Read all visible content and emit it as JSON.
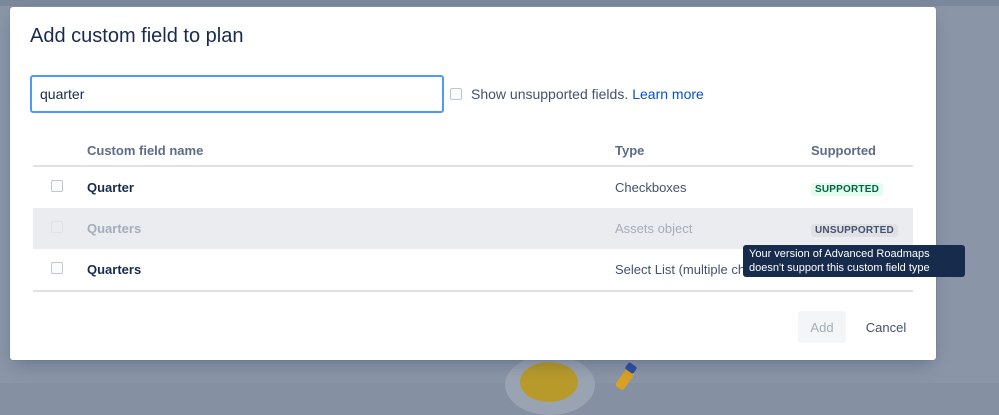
{
  "dialog": {
    "title": "Add custom field to plan",
    "search": {
      "value": "quarter",
      "placeholder": ""
    },
    "show_unsupported": {
      "label": "Show unsupported fields.",
      "link": "Learn more",
      "checked": false
    },
    "table": {
      "headers": {
        "name": "Custom field name",
        "type": "Type",
        "supported": "Supported"
      },
      "rows": [
        {
          "name": "Quarter",
          "type": "Checkboxes",
          "status": "SUPPORTED",
          "disabled": false
        },
        {
          "name": "Quarters",
          "type": "Assets object",
          "status": "UNSUPPORTED",
          "disabled": true
        },
        {
          "name": "Quarters",
          "type": "Select List (multiple ch",
          "status": "",
          "disabled": false
        }
      ]
    },
    "tooltip": {
      "line1": "Your version of Advanced Roadmaps",
      "line2": "doesn't support this custom field type"
    },
    "buttons": {
      "add": "Add",
      "cancel": "Cancel"
    }
  },
  "colors": {
    "accent": "#0052cc",
    "focus_border": "#4c9aff",
    "supported_bg": "#e3fcef",
    "supported_text": "#006644",
    "tooltip_bg": "#172b4d"
  }
}
